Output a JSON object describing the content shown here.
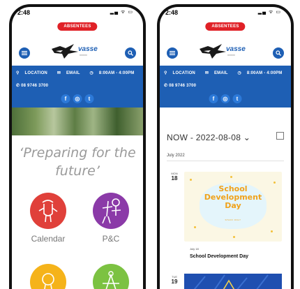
{
  "colors": {
    "brand_blue": "#1e5fb4",
    "alert_red": "#e02127",
    "calendar_red": "#e0403a",
    "pc_purple": "#8b3aa8",
    "yellow": "#f5b31a",
    "green": "#7cc242",
    "event_title_orange": "#f0a21b"
  },
  "status": {
    "time": "2:48",
    "signal_icons": "signal-wifi-battery"
  },
  "alert": {
    "label": "ABSENTEES"
  },
  "header": {
    "logo_text": "vasse",
    "menu_icon": "hamburger-icon",
    "search_icon": "search-icon"
  },
  "infobar": {
    "location": "LOCATION",
    "email": "EMAIL",
    "hours": "8:00AM - 4:00PM",
    "phone": "08 9746 3700",
    "social": [
      "f",
      "◎",
      "t"
    ]
  },
  "left": {
    "tagline": "‘Preparing for the future’",
    "quick_links": [
      {
        "label": "Calendar",
        "icon": "calendar-drawing-icon"
      },
      {
        "label": "P&C",
        "icon": "pc-drawing-icon"
      }
    ]
  },
  "right": {
    "calendar_title": "NOW - 2022-08-08 ⌄",
    "view_icon": "grid-view-icon",
    "month": "July 2022",
    "events": [
      {
        "dow": "MON",
        "day": "18",
        "image_title": "School Development Day",
        "image_title_line1": "School",
        "image_title_line2": "Development",
        "image_title_line3": "Day",
        "image_subtitle": "STAFF ONLY",
        "date_label": "July 18",
        "title": "School Development Day"
      },
      {
        "dow": "TUE",
        "day": "19"
      }
    ]
  }
}
